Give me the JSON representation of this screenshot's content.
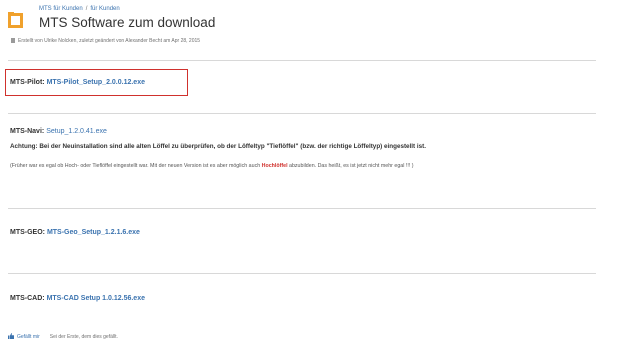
{
  "breadcrumb": {
    "items": [
      "MTS für Kunden",
      "für Kunden"
    ],
    "separator": "/"
  },
  "page": {
    "title": "MTS Software zum download",
    "meta": "Erstellt von Ulrike Nolcken, zuletzt geändert von Alexander Becht am Apr 28, 2015"
  },
  "entries": {
    "pilot": {
      "name": "MTS-Pilot:",
      "link": "MTS-Pilot_Setup_2.0.0.12.exe"
    },
    "navi": {
      "name": "MTS-Navi:",
      "link": "Setup_1.2.0.41.exe",
      "warning": "Achtung: Bei der Neuinstallation sind alle alten Löffel zu überprüfen, ob der Löffeltyp \"Tieflöffel\" (bzw. der richtige Löffeltyp) eingestellt ist.",
      "note_before": "(Früher war es egal ob Hoch- oder Tieflöffel eingestellt war. Mit der neuen Version ist es aber möglich auch ",
      "note_highlight": "Hochlöffel",
      "note_after": " abzubilden. Das heißt, es ist jetzt nicht mehr egal !!! )"
    },
    "geo": {
      "name": "MTS-GEO:",
      "link": "MTS-Geo_Setup_1.2.1.6.exe"
    },
    "cad": {
      "name": "MTS-CAD:",
      "link": "MTS-CAD Setup 1.0.12.56.exe"
    }
  },
  "footer": {
    "like_label": "Gefällt mir",
    "like_text": "Sei der Erste, dem dies gefällt."
  },
  "colors": {
    "link": "#3b73af",
    "highlight_box": "#d0312d",
    "icon_orange": "#f0a12c"
  },
  "icons": {
    "page": "page-icon",
    "meta": "pen-icon",
    "like": "thumbs-up-icon"
  }
}
